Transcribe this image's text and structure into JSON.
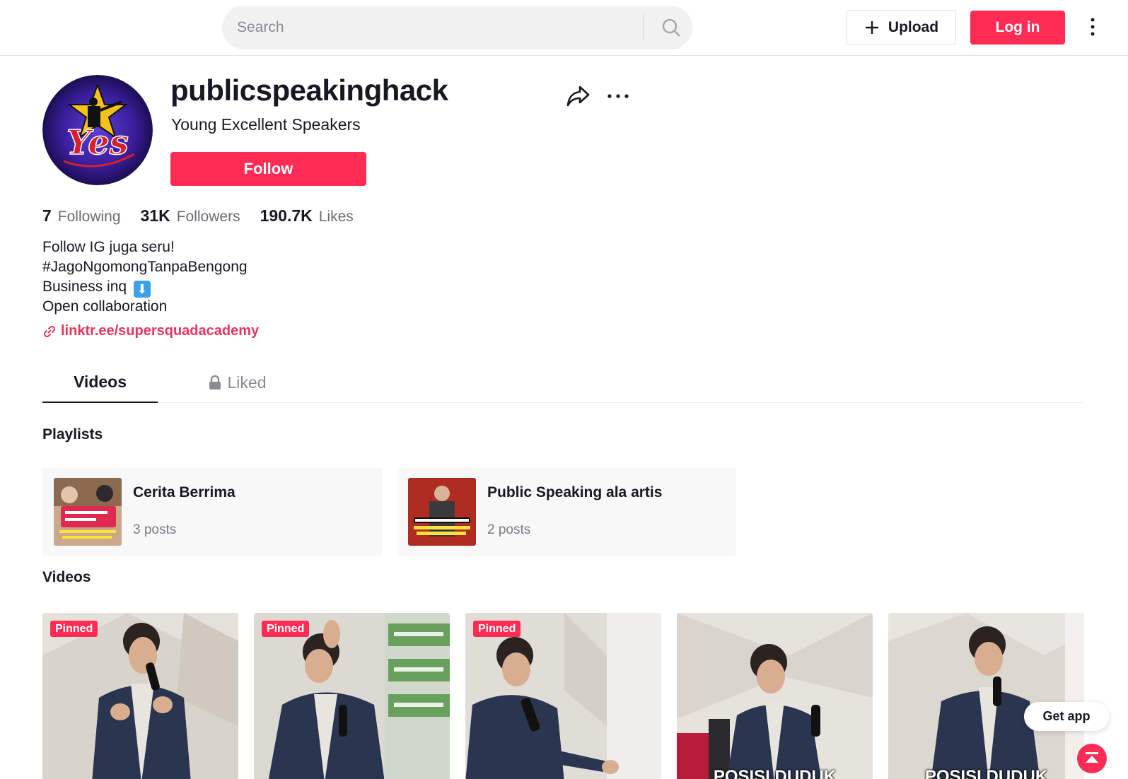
{
  "header": {
    "search_placeholder": "Search",
    "upload_label": "Upload",
    "login_label": "Log in",
    "icons": [
      "search-icon",
      "plus-icon",
      "more-vertical-icon"
    ]
  },
  "profile": {
    "username": "publicspeakinghack",
    "nickname": "Young Excellent Speakers",
    "follow_label": "Follow",
    "stats": [
      {
        "value": "7",
        "label": "Following"
      },
      {
        "value": "31K",
        "label": "Followers"
      },
      {
        "value": "190.7K",
        "label": "Likes"
      }
    ],
    "bio": [
      "Follow IG juga seru!",
      "#JagoNgomongTanpaBengong",
      "Business inq",
      "Open collaboration"
    ],
    "link": "linktr.ee/supersquadacademy",
    "avatar_text": "Yes"
  },
  "tabs": [
    {
      "label": "Videos",
      "active": true
    },
    {
      "label": "Liked",
      "active": false,
      "locked": true
    }
  ],
  "playlists": {
    "title": "Playlists",
    "items": [
      {
        "name": "Cerita Berrima",
        "count": "3 posts"
      },
      {
        "name": "Public Speaking ala artis",
        "count": "2 posts"
      }
    ]
  },
  "videos": {
    "title": "Videos",
    "items": [
      {
        "pinned": "Pinned",
        "caption": ""
      },
      {
        "pinned": "Pinned",
        "caption": ""
      },
      {
        "pinned": "Pinned",
        "caption": ""
      },
      {
        "pinned": "",
        "caption": "POSISI DUDUK"
      },
      {
        "pinned": "",
        "caption": "POSISI DUDUK"
      }
    ]
  },
  "floating": {
    "get_app_label": "Get app"
  },
  "colors": {
    "accent": "#fe2c55",
    "link": "#e5365d",
    "text": "#161823",
    "muted": "#6b6c72"
  }
}
